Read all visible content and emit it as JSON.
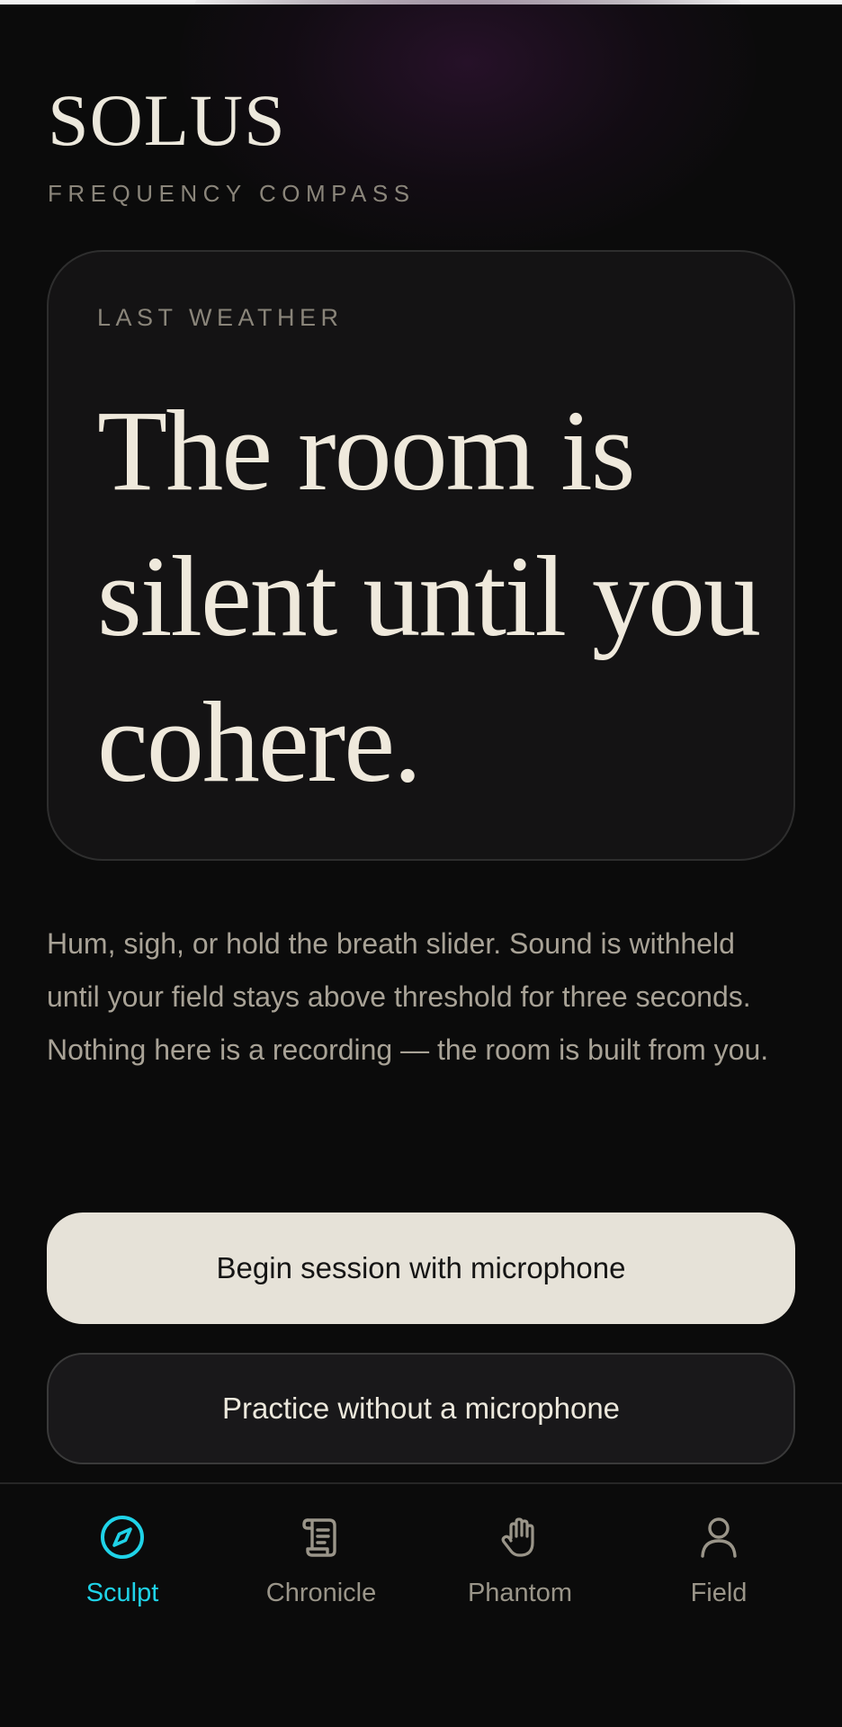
{
  "app": {
    "name": "SOLUS",
    "subtitle": "FREQUENCY COMPASS"
  },
  "weather_card": {
    "label": "LAST WEATHER",
    "quote": "The room is silent until you cohere."
  },
  "description": "Hum, sigh, or hold the breath slider. Sound is withheld until your field stays above threshold for three seconds. Nothing here is a recording — the room is built from you.",
  "actions": {
    "primary_label": "Begin session with microphone",
    "secondary_label": "Practice without a microphone"
  },
  "tabs": [
    {
      "label": "Sculpt",
      "icon": "compass-icon",
      "active": true
    },
    {
      "label": "Chronicle",
      "icon": "scroll-icon",
      "active": false
    },
    {
      "label": "Phantom",
      "icon": "hand-icon",
      "active": false
    },
    {
      "label": "Field",
      "icon": "user-icon",
      "active": false
    }
  ],
  "colors": {
    "background": "#0b0b0b",
    "card": "#141314",
    "text_primary": "#efe9dc",
    "text_muted": "#8a857a",
    "accent": "#1fd3e8",
    "primary_button": "#e6e2d8"
  }
}
